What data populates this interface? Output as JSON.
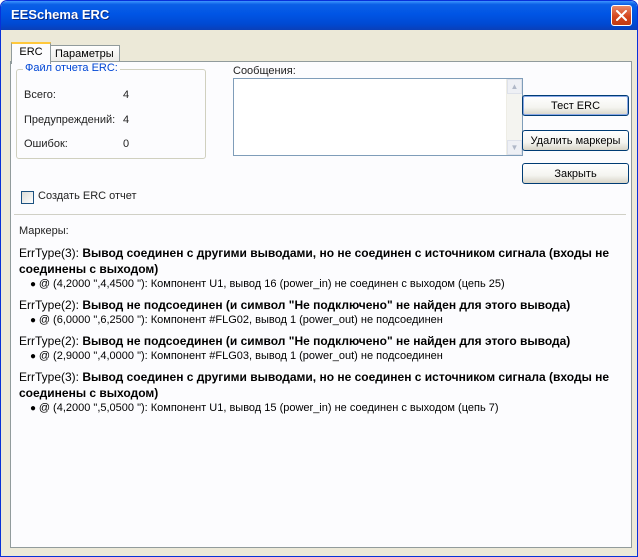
{
  "window": {
    "title": "EESchema ERC",
    "close_icon": "close-x-icon"
  },
  "tabs": [
    {
      "label": "ERC",
      "active": true
    },
    {
      "label": "Параметры",
      "active": false
    }
  ],
  "report_group": {
    "title": "Файл отчета ERC:",
    "rows": [
      {
        "label": "Всего:",
        "value": "4"
      },
      {
        "label": "Предупреждений:",
        "value": "4"
      },
      {
        "label": "Ошибок:",
        "value": "0"
      }
    ]
  },
  "messages": {
    "label": "Сообщения:",
    "content": ""
  },
  "buttons": {
    "test_erc": "Тест ERC",
    "delete_markers": "Удалить маркеры",
    "close": "Закрыть"
  },
  "create_report": {
    "label": "Создать ERC отчет",
    "checked": false
  },
  "markers": {
    "label": "Маркеры:",
    "items": [
      {
        "prefix": "ErrType(3): ",
        "bold": "Вывод соединен с другими выводами, но не соединен с источником сигнала (входы не соединены с выходом)",
        "detail": "@ (4,2000 \",4,4500 \"): Компонент U1, вывод 16 (power_in) не соединен с выходом (цепь 25)"
      },
      {
        "prefix": "ErrType(2): ",
        "bold": "Вывод не подсоединен (и символ \"Не подключено\" не найден для этого вывода)",
        "detail": "@ (6,0000 \",6,2500 \"): Компонент #FLG02, вывод 1 (power_out) не подсоединен"
      },
      {
        "prefix": "ErrType(2): ",
        "bold": "Вывод не подсоединен (и символ \"Не подключено\" не найден для этого вывода)",
        "detail": "@ (2,9000 \",4,0000 \"): Компонент #FLG03, вывод 1 (power_out) не подсоединен"
      },
      {
        "prefix": "ErrType(3): ",
        "bold": "Вывод соединен с другими выводами, но не соединен с источником сигнала (входы не соединены с выходом)",
        "detail": "@ (4,2000 \",5,0500 \"): Компонент U1, вывод 15 (power_in) не соединен с выходом (цепь 7)"
      }
    ]
  }
}
